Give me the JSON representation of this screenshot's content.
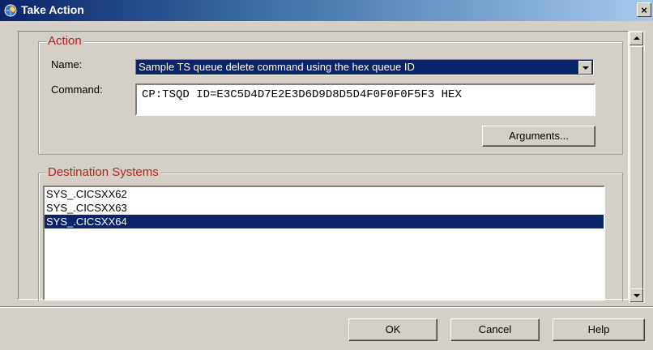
{
  "window": {
    "title": "Take Action",
    "close_label": "×",
    "icon": "globe-pencil-icon"
  },
  "action": {
    "legend": "Action",
    "name_label": "Name:",
    "name_value": "Sample TS queue delete command using the hex queue ID",
    "command_label": "Command:",
    "command_value": "CP:TSQD ID=E3C5D4D7E2E3D6D9D8D5D4F0F0F0F5F3 HEX",
    "arguments_button": "Arguments..."
  },
  "destination": {
    "legend": "Destination Systems",
    "systems": [
      {
        "label": "SYS_.CICSXX62",
        "selected": false
      },
      {
        "label": "SYS_.CICSXX63",
        "selected": false
      },
      {
        "label": "SYS_.CICSXX64",
        "selected": true
      }
    ]
  },
  "buttons": {
    "ok": "OK",
    "cancel": "Cancel",
    "help": "Help"
  },
  "colors": {
    "selection": "#0a246a",
    "legend_text": "#b22222",
    "face": "#d4d0c8"
  }
}
